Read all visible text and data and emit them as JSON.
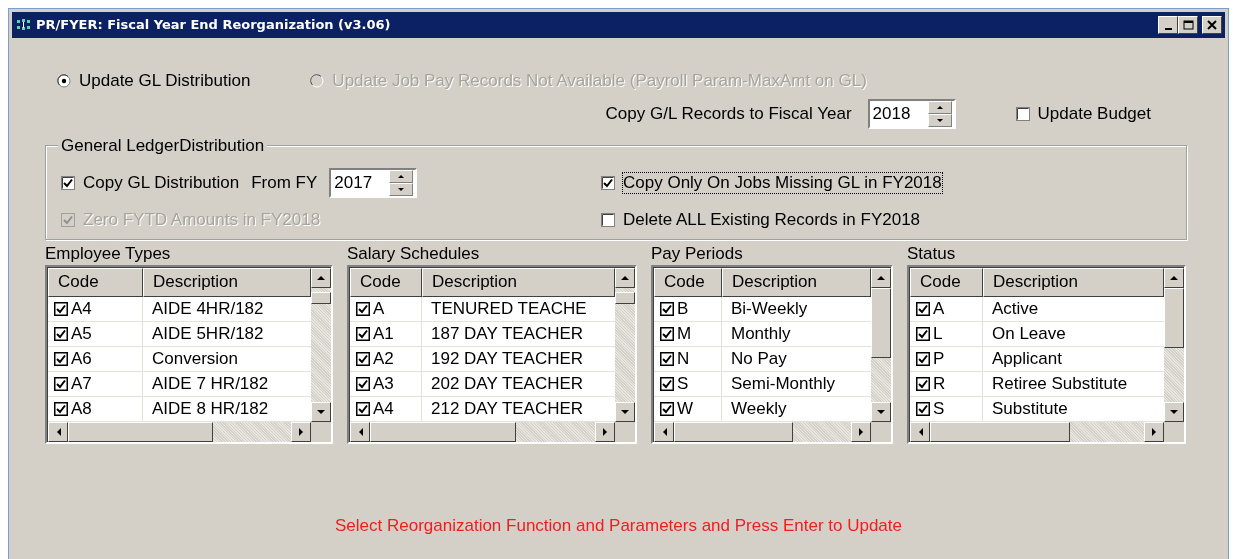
{
  "window": {
    "title": "PR/FYER: Fiscal Year End Reorganization (v3.06)"
  },
  "reorg_options": [
    {
      "label": "Update GL Distribution",
      "selected": true,
      "disabled": false
    },
    {
      "label": "Update Job Pay Records Not Available (Payroll Param-MaxAmt on GL)",
      "selected": false,
      "disabled": true
    }
  ],
  "copy_year": {
    "label": "Copy G/L Records to Fiscal Year",
    "value": "2018"
  },
  "update_budget": {
    "label": "Update Budget",
    "checked": false
  },
  "gl_distribution": {
    "title": "General LedgerDistribution",
    "copy_gl": {
      "label": "Copy GL Distribution",
      "checked": true,
      "disabled": false
    },
    "from_fy": {
      "label": "From FY",
      "value": "2017"
    },
    "zero_fytd": {
      "label": "Zero FYTD Amounts in FY2018",
      "checked": true,
      "disabled": true
    },
    "copy_only_missing": {
      "label": "Copy Only On Jobs Missing GL in FY2018",
      "checked": true,
      "focused": true
    },
    "delete_all": {
      "label": "Delete ALL Existing Records in FY2018",
      "checked": false,
      "focused": false
    }
  },
  "lists": [
    {
      "title": "Employee Types",
      "columns": [
        "Code",
        "Description"
      ],
      "rows": [
        {
          "code": "A4",
          "description": "AIDE 4HR/182",
          "checked": true
        },
        {
          "code": "A5",
          "description": "AIDE 5HR/182",
          "checked": true
        },
        {
          "code": "A6",
          "description": "Conversion",
          "checked": true
        },
        {
          "code": "A7",
          "description": "AIDE 7 HR/182",
          "checked": true
        },
        {
          "code": "A8",
          "description": "AIDE 8 HR/182",
          "checked": true
        }
      ]
    },
    {
      "title": "Salary Schedules",
      "columns": [
        "Code",
        "Description"
      ],
      "rows": [
        {
          "code": "A",
          "description": "TENURED TEACHE",
          "checked": true
        },
        {
          "code": "A1",
          "description": "187 DAY TEACHER",
          "checked": true
        },
        {
          "code": "A2",
          "description": "192 DAY TEACHER",
          "checked": true
        },
        {
          "code": "A3",
          "description": "202 DAY TEACHER",
          "checked": true
        },
        {
          "code": "A4",
          "description": "212 DAY TEACHER",
          "checked": true
        }
      ]
    },
    {
      "title": "Pay Periods",
      "columns": [
        "Code",
        "Description"
      ],
      "rows": [
        {
          "code": "B",
          "description": "Bi-Weekly",
          "checked": true
        },
        {
          "code": "M",
          "description": "Monthly",
          "checked": true
        },
        {
          "code": "N",
          "description": "No Pay",
          "checked": true
        },
        {
          "code": "S",
          "description": "Semi-Monthly",
          "checked": true
        },
        {
          "code": "W",
          "description": "Weekly",
          "checked": true
        }
      ]
    },
    {
      "title": "Status",
      "columns": [
        "Code",
        "Description"
      ],
      "rows": [
        {
          "code": "A",
          "description": "Active",
          "checked": true
        },
        {
          "code": "L",
          "description": "On Leave",
          "checked": true
        },
        {
          "code": "P",
          "description": "Applicant",
          "checked": true
        },
        {
          "code": "R",
          "description": "Retiree Substitute",
          "checked": true
        },
        {
          "code": "S",
          "description": "Substitute",
          "checked": true
        }
      ]
    }
  ],
  "message": "Select Reorganization Function and Parameters and Press Enter to Update"
}
